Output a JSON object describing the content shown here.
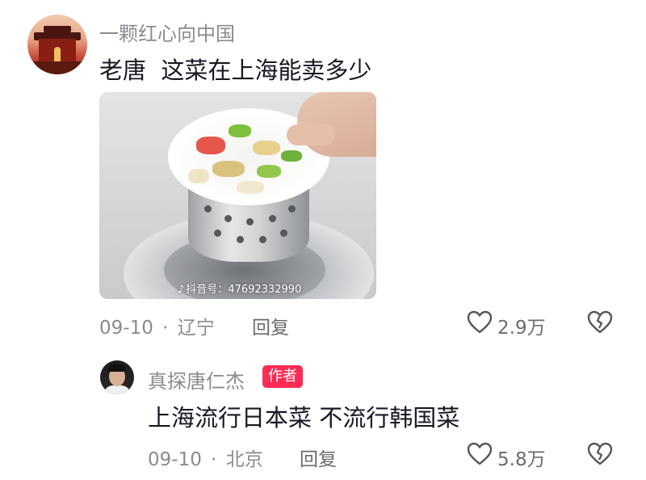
{
  "comment1": {
    "username": "一颗红心向中国",
    "text": "老唐  这菜在上海能卖多少",
    "image_watermark": "抖音号：47692332990",
    "date": "09-10",
    "separator": "·",
    "location": "辽宁",
    "reply_label": "回复",
    "like_count": "2.9万"
  },
  "comment2": {
    "username": "真探唐仁杰",
    "author_badge": "作者",
    "text": "上海流行日本菜 不流行韩国菜",
    "date": "09-10",
    "separator": "·",
    "location": "北京",
    "reply_label": "回复",
    "like_count": "5.8万"
  },
  "icons": {
    "like": "heart-outline-icon",
    "dislike": "broken-heart-icon",
    "watermark_logo": "tiktok-logo-icon"
  },
  "colors": {
    "author_badge_bg": "#fe2c55",
    "secondary_text": "#8a8b91",
    "primary_text": "#161823"
  }
}
